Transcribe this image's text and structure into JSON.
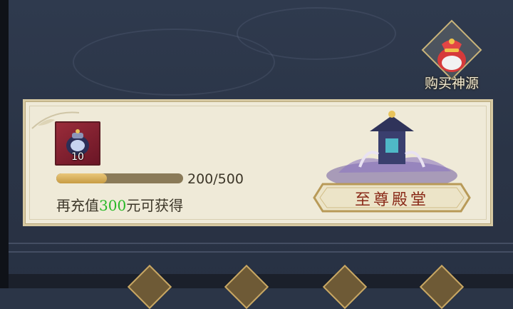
{
  "buy_button": {
    "label": "购买神源",
    "icon": "treasure-bag-icon"
  },
  "reward_panel": {
    "item": {
      "icon": "spirit-orb-item-icon",
      "count": "10"
    },
    "progress": {
      "current": 200,
      "max": 500,
      "fraction": 0.4,
      "text": "200/500"
    },
    "recharge": {
      "prefix": "再充值",
      "amount": "300",
      "suffix": "元可获得"
    },
    "hall_button": {
      "label": "至尊殿堂"
    }
  },
  "colors": {
    "amount": "#26b826",
    "panel": "#efead8",
    "background": "#2b3547",
    "accent_gold": "#c8a764"
  }
}
